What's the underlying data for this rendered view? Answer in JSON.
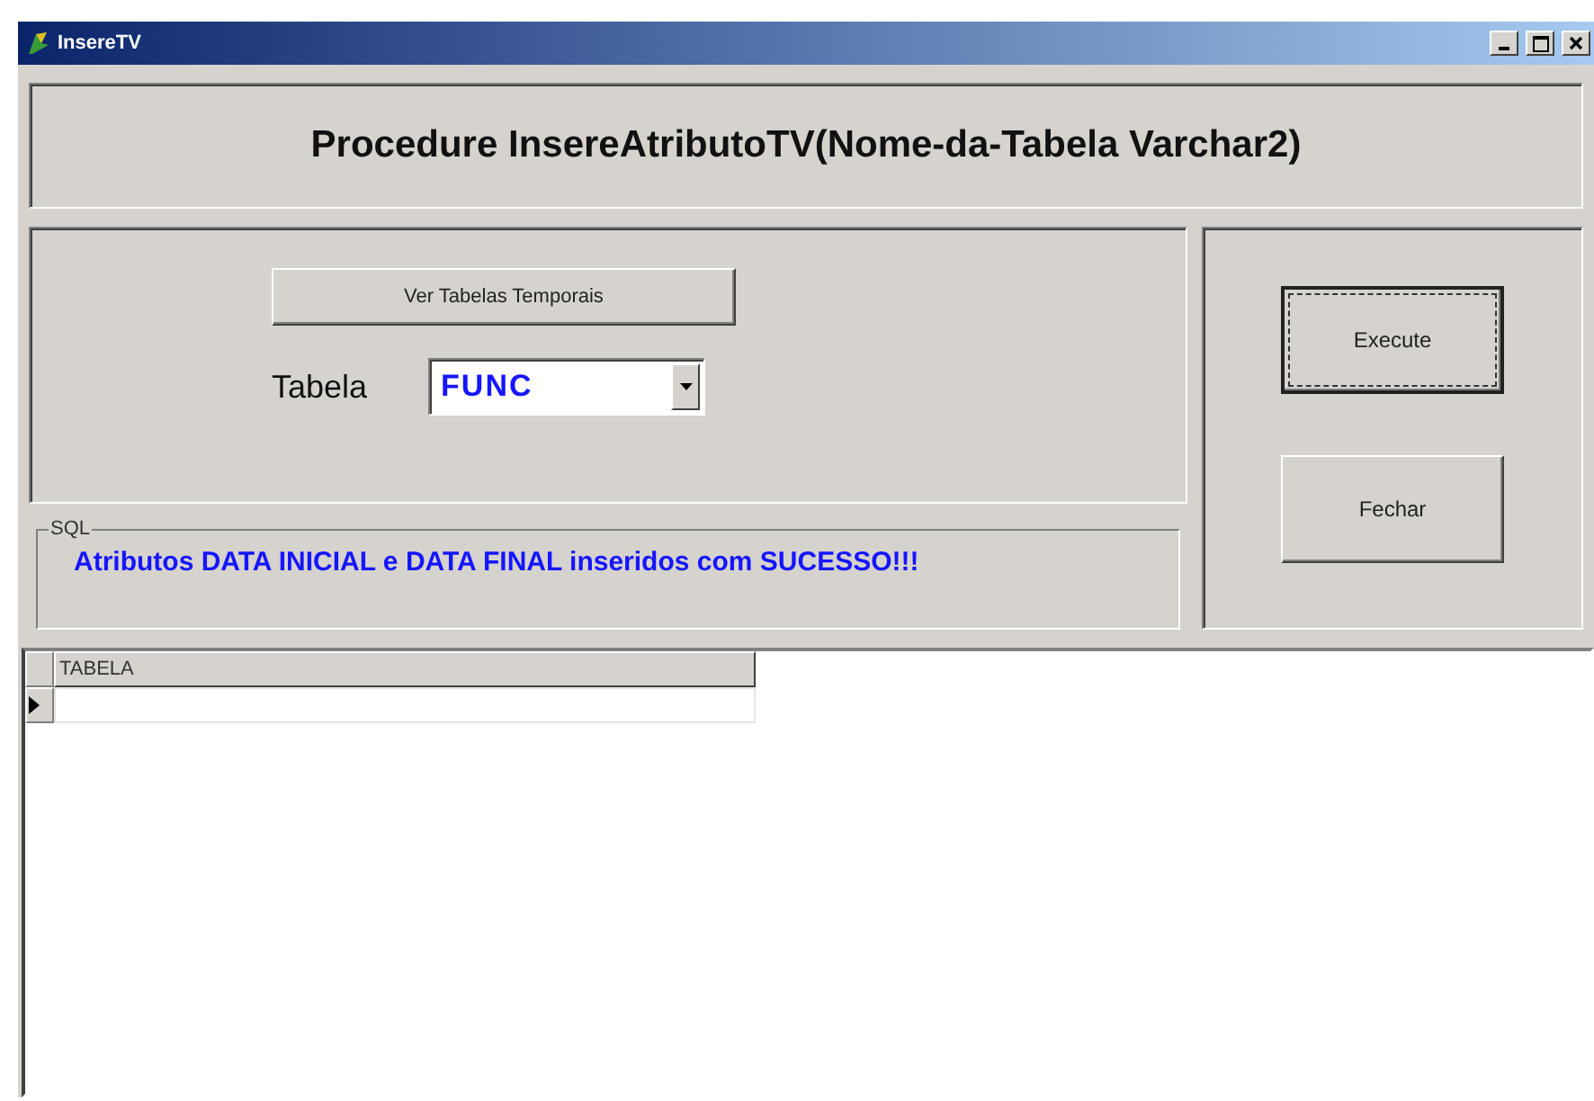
{
  "window": {
    "title": "InsereTV"
  },
  "header": {
    "title": "Procedure InsereAtributoTV(Nome-da-Tabela Varchar2)"
  },
  "form": {
    "view_button": "Ver Tabelas Temporais",
    "table_label": "Tabela",
    "table_value": "FUNC"
  },
  "sql": {
    "legend": "SQL",
    "message": "Atributos DATA INICIAL e DATA FINAL inseridos com SUCESSO!!!"
  },
  "buttons": [
    {
      "label": "Execute",
      "focused": true
    },
    {
      "label": "Fechar",
      "focused": false
    }
  ],
  "grid": {
    "columns": [
      "TABELA"
    ]
  }
}
